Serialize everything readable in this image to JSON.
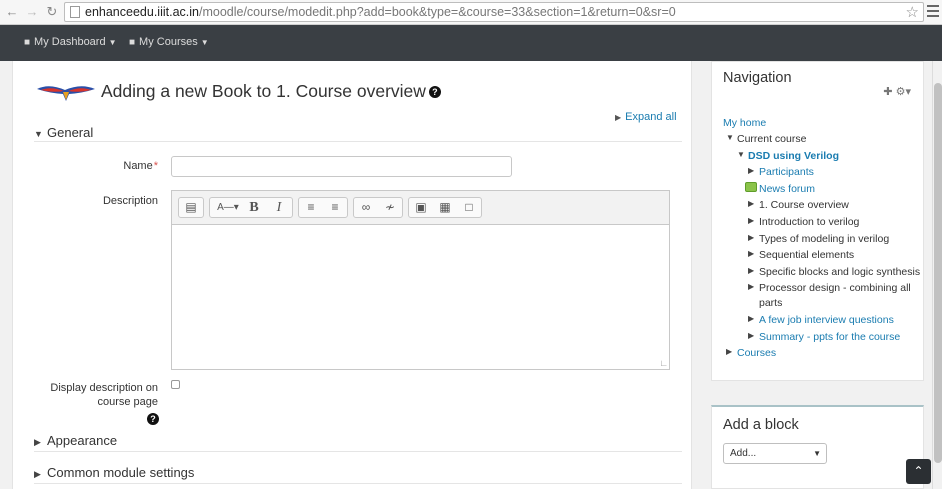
{
  "browser": {
    "url_host": "enhanceedu.iiit.ac.in",
    "url_path": "/moodle/course/modedit.php?add=book&type=&course=33&section=1&return=0&sr=0"
  },
  "navbar": {
    "items": [
      {
        "label": "My Dashboard"
      },
      {
        "label": "My Courses"
      }
    ]
  },
  "page": {
    "title": "Adding a new Book to 1. Course overview",
    "expand_all": "Expand all"
  },
  "form": {
    "general_header": "General",
    "name_label": "Name",
    "name_value": "",
    "description_label": "Description",
    "display_desc_label_line1": "Display description on",
    "display_desc_label_line2": "course page",
    "appearance_header": "Appearance",
    "common_settings_header": "Common module settings"
  },
  "navigation": {
    "title": "Navigation",
    "my_home": "My home",
    "current_course": "Current course",
    "course_name": "DSD using Verilog",
    "items": [
      {
        "label": "Participants",
        "type": "link"
      },
      {
        "label": "News forum",
        "type": "forum"
      },
      {
        "label": "1. Course overview",
        "type": "section"
      },
      {
        "label": "Introduction to verilog",
        "type": "section"
      },
      {
        "label": "Types of modeling in verilog",
        "type": "section"
      },
      {
        "label": "Sequential elements",
        "type": "section"
      },
      {
        "label": "Specific blocks and logic synthesis",
        "type": "section"
      },
      {
        "label": "Processor design - combining all",
        "type": "section"
      },
      {
        "label": "parts",
        "type": "continuation"
      },
      {
        "label": "A few job interview questions",
        "type": "link"
      },
      {
        "label": "Summary - ppts for the course",
        "type": "link"
      }
    ],
    "courses": "Courses"
  },
  "add_block": {
    "title": "Add a block",
    "select_value": "Add..."
  },
  "colors": {
    "navbar_bg": "#3a3f44",
    "link": "#1a7cb0",
    "required": "#d9534f"
  }
}
